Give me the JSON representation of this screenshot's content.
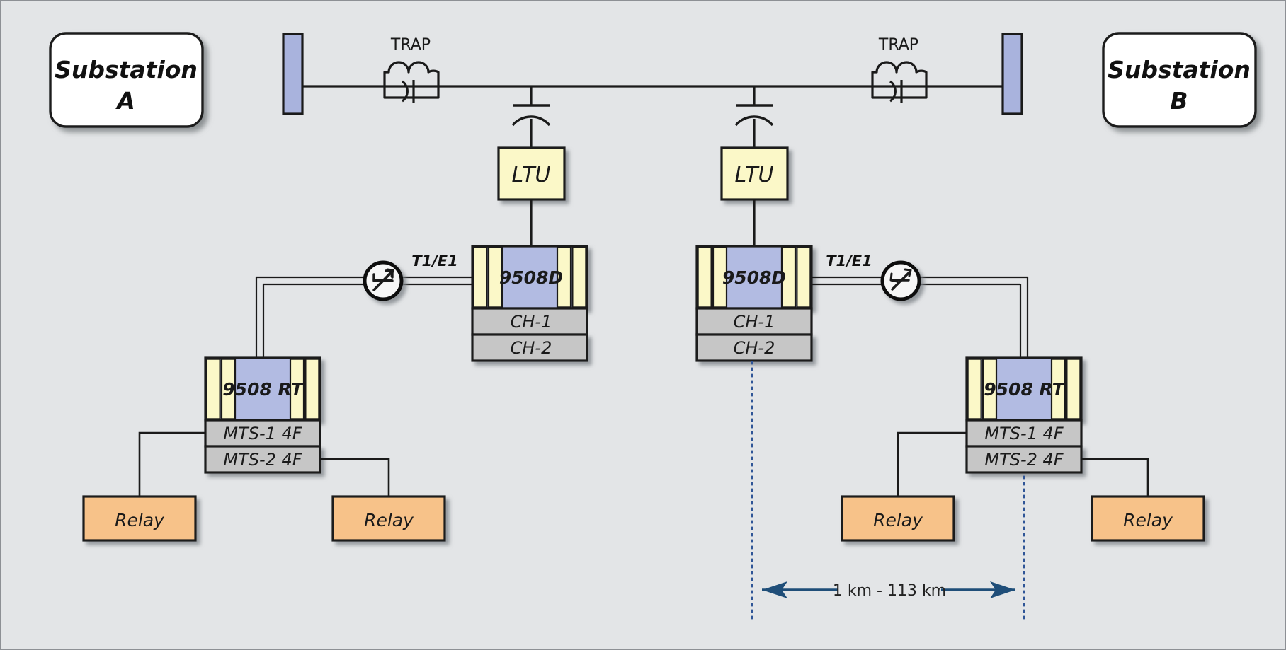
{
  "diagram": {
    "title": "Teleprotection network over power line carrier between two substations",
    "background_color": "#e3e5e7",
    "border_color": "#8d9095"
  },
  "substations": [
    {
      "id": "A",
      "line1": "Substation",
      "line2": "A",
      "fill": "#ffffff"
    },
    {
      "id": "B",
      "line1": "Substation",
      "line2": "B",
      "fill": "#ffffff"
    }
  ],
  "busbars": [
    {
      "id": "left-busbar",
      "fill": "#a9b3dd"
    },
    {
      "id": "right-busbar",
      "fill": "#a9b3dd"
    }
  ],
  "traps": [
    {
      "id": "left-trap",
      "label": "TRAP"
    },
    {
      "id": "right-trap",
      "label": "TRAP"
    }
  ],
  "ltus": [
    {
      "id": "left-ltu",
      "label": "LTU",
      "fill": "#fbf8c8"
    },
    {
      "id": "right-ltu",
      "label": "LTU",
      "fill": "#fbf8c8"
    }
  ],
  "multiplexers_9508d": [
    {
      "id": "left-9508d",
      "name": "9508D",
      "body_fill": "#b2bbe2",
      "card_fill": "#fbf8c8",
      "rows": [
        {
          "label": "CH-1",
          "fill": "#c6c6c6"
        },
        {
          "label": "CH-2",
          "fill": "#c6c6c6"
        }
      ]
    },
    {
      "id": "right-9508d",
      "name": "9508D",
      "body_fill": "#b2bbe2",
      "card_fill": "#fbf8c8",
      "rows": [
        {
          "label": "CH-1",
          "fill": "#c6c6c6"
        },
        {
          "label": "CH-2",
          "fill": "#c6c6c6"
        }
      ]
    }
  ],
  "remote_terminals_9508rt": [
    {
      "id": "left-9508rt",
      "name": "9508 RT",
      "body_fill": "#b2bbe2",
      "card_fill": "#fbf8c8",
      "rows": [
        {
          "label": "MTS-1 4F",
          "fill": "#c6c6c6"
        },
        {
          "label": "MTS-2 4F",
          "fill": "#c6c6c6"
        }
      ]
    },
    {
      "id": "right-9508rt",
      "name": "9508 RT",
      "body_fill": "#b2bbe2",
      "card_fill": "#fbf8c8",
      "rows": [
        {
          "label": "MTS-1 4F",
          "fill": "#c6c6c6"
        },
        {
          "label": "MTS-2 4F",
          "fill": "#c6c6c6"
        }
      ]
    }
  ],
  "relays": [
    {
      "id": "relay-a1",
      "label": "Relay",
      "fill": "#f7c289"
    },
    {
      "id": "relay-a2",
      "label": "Relay",
      "fill": "#f7c289"
    },
    {
      "id": "relay-b1",
      "label": "Relay",
      "fill": "#f7c289"
    },
    {
      "id": "relay-b2",
      "label": "Relay",
      "fill": "#f7c289"
    }
  ],
  "links": [
    {
      "id": "left-t1e1",
      "label": "T1/E1"
    },
    {
      "id": "right-t1e1",
      "label": "T1/E1"
    }
  ],
  "isolators": [
    {
      "id": "left-isolator",
      "icon": "isolator-zigzag-icon"
    },
    {
      "id": "right-isolator",
      "icon": "isolator-zigzag-icon"
    }
  ],
  "distance_annotation": {
    "label": "1 km - 113 km",
    "arrow_color": "#1f4e79",
    "guide_color": "#2f5597"
  }
}
